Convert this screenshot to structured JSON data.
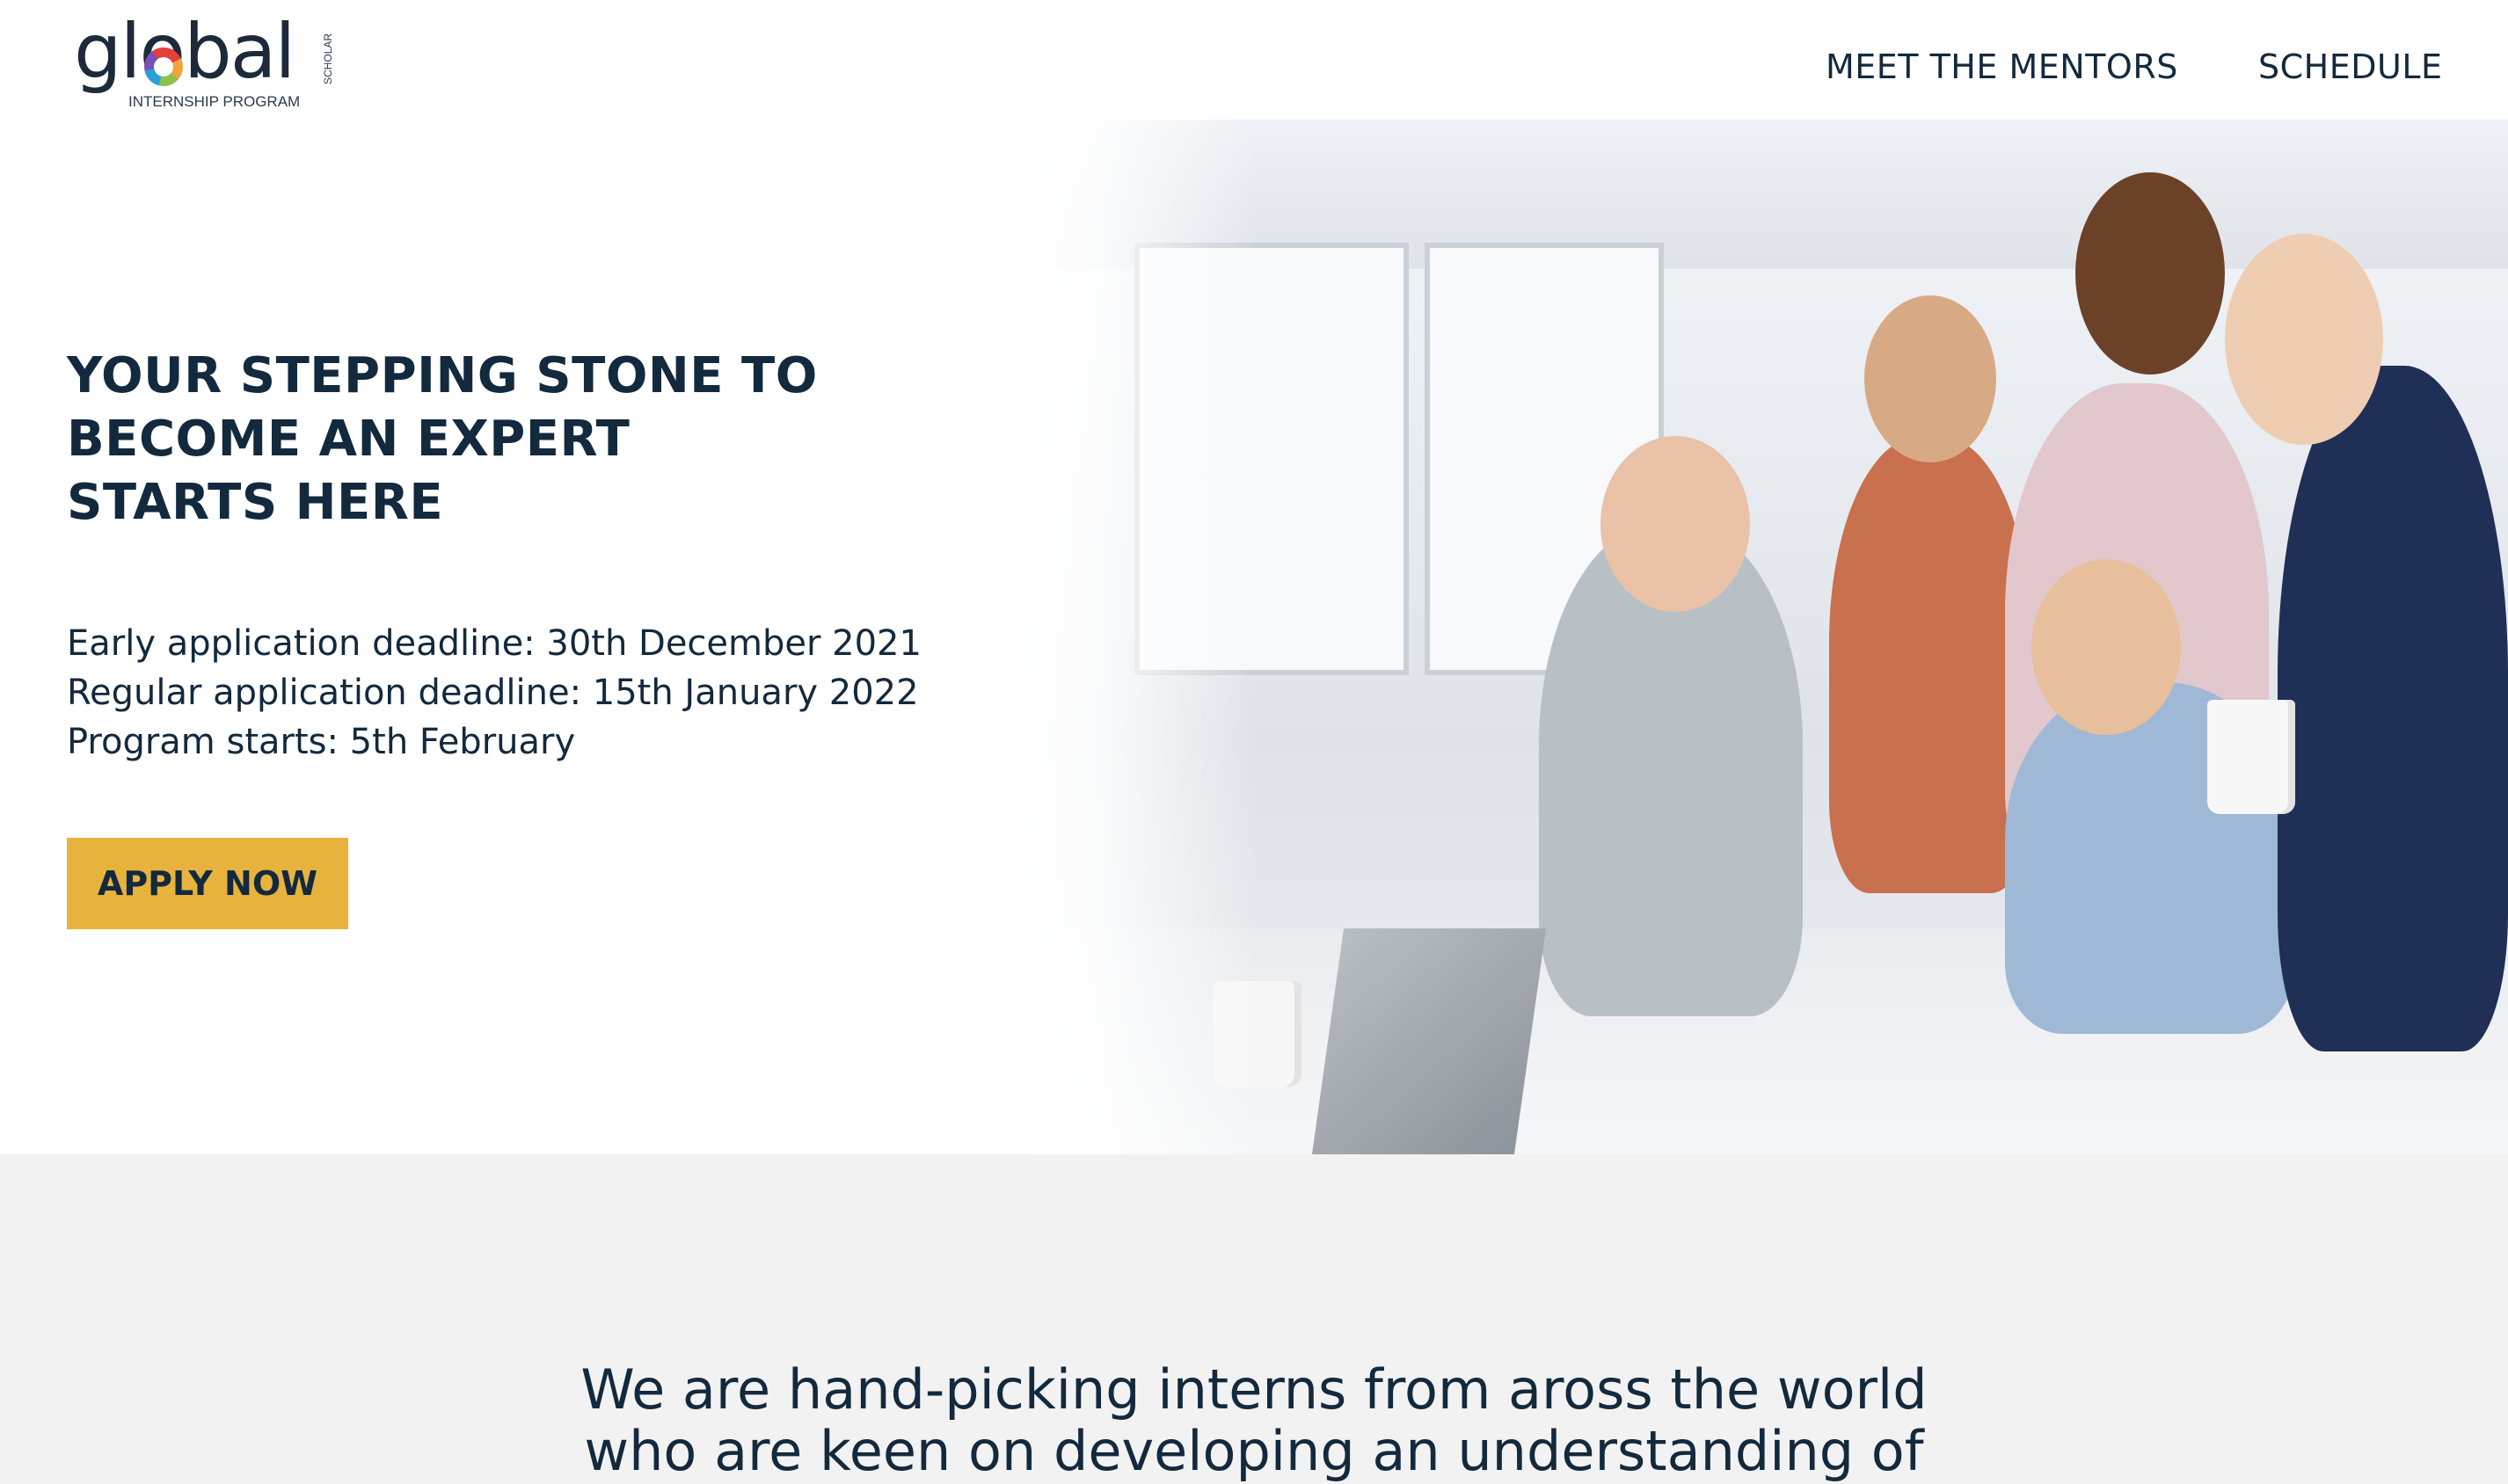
{
  "header": {
    "logo": {
      "wordmark": "global",
      "subtitle": "INTERNSHIP PROGRAM",
      "side_text": "SCHOLAR"
    },
    "nav": [
      {
        "label": "MEET THE MENTORS"
      },
      {
        "label": "SCHEDULE"
      }
    ]
  },
  "hero": {
    "headline": [
      "YOUR STEPPING STONE TO",
      "BECOME AN EXPERT",
      "STARTS HERE"
    ],
    "dates": [
      "Early application deadline: 30th December 2021",
      "Regular application deadline: 15th January 2022",
      "Program starts: 5th February"
    ],
    "cta_label": "APPLY NOW",
    "image_subject": "team-of-interns-at-office-desk-photo"
  },
  "intro": {
    "lines": [
      "We are hand-picking interns from aross the world",
      "who are keen on developing an understanding of"
    ]
  },
  "colors": {
    "accent": "#E8B33D",
    "text": "#13293D",
    "section_bg": "#F2F2F2"
  }
}
